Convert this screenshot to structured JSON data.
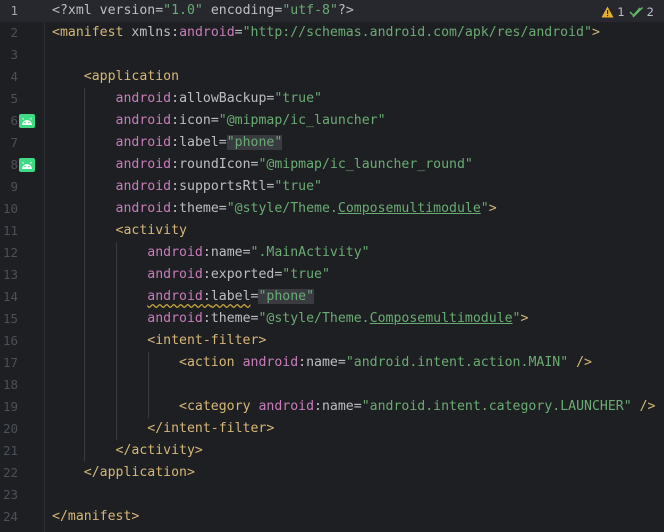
{
  "inspections": {
    "warning_count": "1",
    "weak_warning_count": "2",
    "warning_icon": "warning-triangle-icon",
    "weak_warning_icon": "double-check-icon"
  },
  "lines": [
    {
      "n": "1",
      "tokens": [
        {
          "t": "<?xml ",
          "c": "plain"
        },
        {
          "t": "version",
          "c": "attr"
        },
        {
          "t": "=",
          "c": "plain"
        },
        {
          "t": "\"1.0\"",
          "c": "str"
        },
        {
          "t": " ",
          "c": "plain"
        },
        {
          "t": "encoding",
          "c": "attr"
        },
        {
          "t": "=",
          "c": "plain"
        },
        {
          "t": "\"utf-8\"",
          "c": "str"
        },
        {
          "t": "?>",
          "c": "plain"
        }
      ]
    },
    {
      "n": "2",
      "tokens": [
        {
          "t": "<manifest ",
          "c": "tag"
        },
        {
          "t": "xmlns",
          "c": "attr"
        },
        {
          "t": ":",
          "c": "plain"
        },
        {
          "t": "android",
          "c": "ns"
        },
        {
          "t": "=",
          "c": "plain"
        },
        {
          "t": "\"http://schemas.android.com/apk/res/android\"",
          "c": "str"
        },
        {
          "t": ">",
          "c": "tag"
        }
      ]
    },
    {
      "n": "3",
      "tokens": []
    },
    {
      "n": "4",
      "tokens": [
        {
          "t": "    ",
          "c": "plain"
        },
        {
          "t": "<application",
          "c": "tag"
        }
      ]
    },
    {
      "n": "5",
      "tokens": [
        {
          "t": "        ",
          "c": "plain"
        },
        {
          "t": "android",
          "c": "ns"
        },
        {
          "t": ":",
          "c": "plain"
        },
        {
          "t": "allowBackup",
          "c": "attr"
        },
        {
          "t": "=",
          "c": "plain"
        },
        {
          "t": "\"true\"",
          "c": "str"
        }
      ]
    },
    {
      "n": "6",
      "icon": "android-icon",
      "tokens": [
        {
          "t": "        ",
          "c": "plain"
        },
        {
          "t": "android",
          "c": "ns"
        },
        {
          "t": ":",
          "c": "plain"
        },
        {
          "t": "icon",
          "c": "attr"
        },
        {
          "t": "=",
          "c": "plain"
        },
        {
          "t": "\"@mipmap/ic_launcher\"",
          "c": "str"
        }
      ]
    },
    {
      "n": "7",
      "tokens": [
        {
          "t": "        ",
          "c": "plain"
        },
        {
          "t": "android",
          "c": "ns"
        },
        {
          "t": ":",
          "c": "plain"
        },
        {
          "t": "label",
          "c": "attr"
        },
        {
          "t": "=",
          "c": "plain"
        },
        {
          "t": "\"phone\"",
          "c": "str hl"
        }
      ]
    },
    {
      "n": "8",
      "icon": "android-icon",
      "tokens": [
        {
          "t": "        ",
          "c": "plain"
        },
        {
          "t": "android",
          "c": "ns"
        },
        {
          "t": ":",
          "c": "plain"
        },
        {
          "t": "roundIcon",
          "c": "attr"
        },
        {
          "t": "=",
          "c": "plain"
        },
        {
          "t": "\"@mipmap/ic_launcher_round\"",
          "c": "str"
        }
      ]
    },
    {
      "n": "9",
      "tokens": [
        {
          "t": "        ",
          "c": "plain"
        },
        {
          "t": "android",
          "c": "ns"
        },
        {
          "t": ":",
          "c": "plain"
        },
        {
          "t": "supportsRtl",
          "c": "attr"
        },
        {
          "t": "=",
          "c": "plain"
        },
        {
          "t": "\"true\"",
          "c": "str"
        }
      ]
    },
    {
      "n": "10",
      "tokens": [
        {
          "t": "        ",
          "c": "plain"
        },
        {
          "t": "android",
          "c": "ns"
        },
        {
          "t": ":",
          "c": "plain"
        },
        {
          "t": "theme",
          "c": "attr"
        },
        {
          "t": "=",
          "c": "plain"
        },
        {
          "t": "\"@style/Theme.",
          "c": "str"
        },
        {
          "t": "Composemultimodule",
          "c": "str und"
        },
        {
          "t": "\"",
          "c": "str"
        },
        {
          "t": ">",
          "c": "tag"
        }
      ]
    },
    {
      "n": "11",
      "tokens": [
        {
          "t": "        ",
          "c": "plain"
        },
        {
          "t": "<activity",
          "c": "tag"
        }
      ]
    },
    {
      "n": "12",
      "tokens": [
        {
          "t": "            ",
          "c": "plain"
        },
        {
          "t": "android",
          "c": "ns"
        },
        {
          "t": ":",
          "c": "plain"
        },
        {
          "t": "name",
          "c": "attr"
        },
        {
          "t": "=",
          "c": "plain"
        },
        {
          "t": "\".MainActivity\"",
          "c": "str"
        }
      ]
    },
    {
      "n": "13",
      "tokens": [
        {
          "t": "            ",
          "c": "plain"
        },
        {
          "t": "android",
          "c": "ns"
        },
        {
          "t": ":",
          "c": "plain"
        },
        {
          "t": "exported",
          "c": "attr"
        },
        {
          "t": "=",
          "c": "plain"
        },
        {
          "t": "\"true\"",
          "c": "str"
        }
      ]
    },
    {
      "n": "14",
      "tokens": [
        {
          "t": "            ",
          "c": "plain"
        },
        {
          "t": "android",
          "c": "ns warn-und"
        },
        {
          "t": ":",
          "c": "plain warn-und"
        },
        {
          "t": "label",
          "c": "attr warn-und"
        },
        {
          "t": "=",
          "c": "plain"
        },
        {
          "t": "\"phone\"",
          "c": "str hl"
        }
      ]
    },
    {
      "n": "15",
      "tokens": [
        {
          "t": "            ",
          "c": "plain"
        },
        {
          "t": "android",
          "c": "ns"
        },
        {
          "t": ":",
          "c": "plain"
        },
        {
          "t": "theme",
          "c": "attr"
        },
        {
          "t": "=",
          "c": "plain"
        },
        {
          "t": "\"@style/Theme.",
          "c": "str"
        },
        {
          "t": "Composemultimodule",
          "c": "str und"
        },
        {
          "t": "\"",
          "c": "str"
        },
        {
          "t": ">",
          "c": "tag"
        }
      ]
    },
    {
      "n": "16",
      "tokens": [
        {
          "t": "            ",
          "c": "plain"
        },
        {
          "t": "<intent-filter>",
          "c": "tag"
        }
      ]
    },
    {
      "n": "17",
      "tokens": [
        {
          "t": "                ",
          "c": "plain"
        },
        {
          "t": "<action ",
          "c": "tag"
        },
        {
          "t": "android",
          "c": "ns"
        },
        {
          "t": ":",
          "c": "plain"
        },
        {
          "t": "name",
          "c": "attr"
        },
        {
          "t": "=",
          "c": "plain"
        },
        {
          "t": "\"android.intent.action.MAIN\"",
          "c": "str"
        },
        {
          "t": " />",
          "c": "tag"
        }
      ]
    },
    {
      "n": "18",
      "tokens": []
    },
    {
      "n": "19",
      "tokens": [
        {
          "t": "                ",
          "c": "plain"
        },
        {
          "t": "<category ",
          "c": "tag"
        },
        {
          "t": "android",
          "c": "ns"
        },
        {
          "t": ":",
          "c": "plain"
        },
        {
          "t": "name",
          "c": "attr"
        },
        {
          "t": "=",
          "c": "plain"
        },
        {
          "t": "\"android.intent.category.LAUNCHER\"",
          "c": "str"
        },
        {
          "t": " />",
          "c": "tag"
        }
      ]
    },
    {
      "n": "20",
      "tokens": [
        {
          "t": "            ",
          "c": "plain"
        },
        {
          "t": "</intent-filter>",
          "c": "tag"
        }
      ]
    },
    {
      "n": "21",
      "tokens": [
        {
          "t": "        ",
          "c": "plain"
        },
        {
          "t": "</activity>",
          "c": "tag"
        }
      ]
    },
    {
      "n": "22",
      "tokens": [
        {
          "t": "    ",
          "c": "plain"
        },
        {
          "t": "</application>",
          "c": "tag"
        }
      ]
    },
    {
      "n": "23",
      "tokens": []
    },
    {
      "n": "24",
      "tokens": [
        {
          "t": "</manifest>",
          "c": "tag"
        }
      ]
    }
  ],
  "current_line": "1"
}
